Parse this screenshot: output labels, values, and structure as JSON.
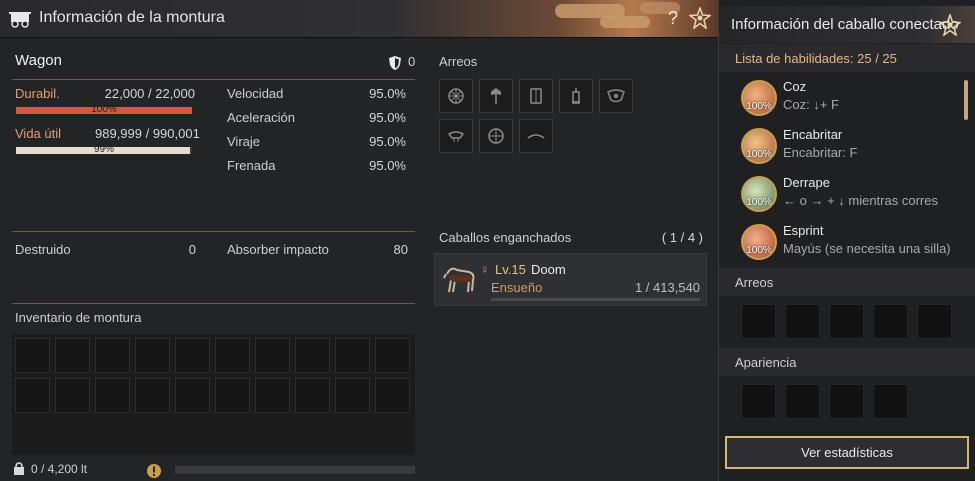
{
  "window": {
    "title": "Información de la montura"
  },
  "icons": {
    "wagon": "wagon-icon",
    "help": "help-icon",
    "star": "star-icon",
    "shield": "shield-icon",
    "weight": "weight-icon",
    "warning": "warning-icon",
    "horse": "horse-icon",
    "female": "female-icon"
  },
  "mount": {
    "name": "Wagon",
    "armor": "0",
    "durability_label": "Durabil.",
    "durability_value": "22,000 / 22,000",
    "durability_pct": "100%",
    "durability_fraction": 1.0,
    "life_label": "Vida útil",
    "life_value": "989,999 / 990,001",
    "life_pct": "99%",
    "life_fraction": 0.99,
    "stats": [
      {
        "label": "Velocidad",
        "value": "95.0%"
      },
      {
        "label": "Aceleración",
        "value": "95.0%"
      },
      {
        "label": "Viraje",
        "value": "95.0%"
      },
      {
        "label": "Frenada",
        "value": "95.0%"
      }
    ],
    "destroyed_label": "Destruido",
    "destroyed_value": "0",
    "impact_label": "Absorber impacto",
    "impact_value": "80"
  },
  "gear": {
    "title": "Arreos"
  },
  "inventory": {
    "title": "Inventario de montura",
    "weight": "0 / 4,200 lt"
  },
  "hitched": {
    "title": "Caballos enganchados",
    "count": "( 1 / 4 )",
    "horse_level": "Lv.15",
    "horse_name": "Doom",
    "horse_sub": "Ensueño",
    "horse_exp": "1 / 413,540"
  },
  "connected": {
    "title": "Información del caballo conectado",
    "skills_label": "Lista de habilidades: 25 / 25",
    "skills": [
      {
        "name": "Coz",
        "desc": "Coz: ↓+ F",
        "pct": "100%"
      },
      {
        "name": "Encabritar",
        "desc": "Encabritar: F",
        "pct": "100%"
      },
      {
        "name": "Derrape",
        "desc": "← o → + ↓ mientras corres",
        "pct": "100%"
      },
      {
        "name": "Esprint",
        "desc": "Mayús (se necesita una silla)",
        "pct": "100%"
      }
    ],
    "gear_title": "Arreos",
    "appearance_title": "Apariencia",
    "stats_button": "Ver estadísticas"
  }
}
